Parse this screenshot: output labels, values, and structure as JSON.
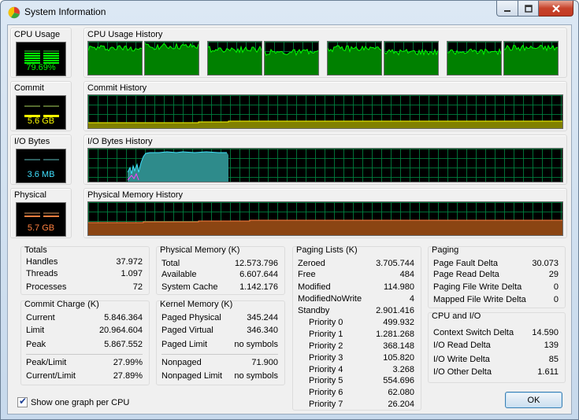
{
  "window": {
    "title": "System Information"
  },
  "meters": {
    "cpu": {
      "label": "CPU Usage",
      "value": "79.69%",
      "color": "#00ff00"
    },
    "commit": {
      "label": "Commit",
      "value": "5.6 GB",
      "color": "#ffff00"
    },
    "io": {
      "label": "I/O Bytes",
      "value": "3.6  MB",
      "color": "#40e0ff"
    },
    "physical": {
      "label": "Physical",
      "value": "5.7 GB",
      "color": "#ff8040"
    }
  },
  "histories": {
    "cpu": "CPU Usage History",
    "commit": "Commit History",
    "io": "I/O Bytes History",
    "physical": "Physical Memory History"
  },
  "cpu_history_graphs": [
    0.82,
    0.86,
    0.78,
    0.69,
    0.8,
    0.7,
    0.72,
    0.82
  ],
  "totals": {
    "title": "Totals",
    "rows": [
      {
        "k": "Handles",
        "v": "37.972"
      },
      {
        "k": "Threads",
        "v": "1.097"
      },
      {
        "k": "Processes",
        "v": "72"
      }
    ]
  },
  "commit_charge": {
    "title": "Commit Charge (K)",
    "rows": [
      {
        "k": "Current",
        "v": "5.846.364"
      },
      {
        "k": "Limit",
        "v": "20.964.604"
      },
      {
        "k": "Peak",
        "v": "5.867.552"
      }
    ],
    "rows2": [
      {
        "k": "Peak/Limit",
        "v": "27.99%"
      },
      {
        "k": "Current/Limit",
        "v": "27.89%"
      }
    ]
  },
  "physical_memory": {
    "title": "Physical Memory (K)",
    "rows": [
      {
        "k": "Total",
        "v": "12.573.796"
      },
      {
        "k": "Available",
        "v": "6.607.644"
      },
      {
        "k": "System Cache",
        "v": "1.142.176"
      }
    ]
  },
  "kernel_memory": {
    "title": "Kernel Memory (K)",
    "rows": [
      {
        "k": "Paged Physical",
        "v": "345.244"
      },
      {
        "k": "Paged Virtual",
        "v": "346.340"
      },
      {
        "k": "Paged Limit",
        "v": "no symbols"
      }
    ],
    "rows2": [
      {
        "k": "Nonpaged",
        "v": "71.900"
      },
      {
        "k": "Nonpaged Limit",
        "v": "no symbols"
      }
    ]
  },
  "paging_lists": {
    "title": "Paging Lists (K)",
    "rows": [
      {
        "k": "Zeroed",
        "v": "3.705.744"
      },
      {
        "k": "Free",
        "v": "484"
      },
      {
        "k": "Modified",
        "v": "114.980"
      },
      {
        "k": "ModifiedNoWrite",
        "v": "4"
      },
      {
        "k": "Standby",
        "v": "2.901.416"
      }
    ],
    "priorities": [
      {
        "k": "Priority 0",
        "v": "499.932"
      },
      {
        "k": "Priority 1",
        "v": "1.281.268"
      },
      {
        "k": "Priority 2",
        "v": "368.148"
      },
      {
        "k": "Priority 3",
        "v": "105.820"
      },
      {
        "k": "Priority 4",
        "v": "3.268"
      },
      {
        "k": "Priority 5",
        "v": "554.696"
      },
      {
        "k": "Priority 6",
        "v": "62.080"
      },
      {
        "k": "Priority 7",
        "v": "26.204"
      }
    ]
  },
  "paging": {
    "title": "Paging",
    "rows": [
      {
        "k": "Page Fault Delta",
        "v": "30.073"
      },
      {
        "k": "Page Read Delta",
        "v": "29"
      },
      {
        "k": "Paging File Write Delta",
        "v": "0"
      },
      {
        "k": "Mapped File Write Delta",
        "v": "0"
      }
    ]
  },
  "cpu_io": {
    "title": "CPU and I/O",
    "rows": [
      {
        "k": "Context Switch Delta",
        "v": "14.590"
      },
      {
        "k": "I/O Read Delta",
        "v": "139"
      },
      {
        "k": "I/O Write Delta",
        "v": "85"
      },
      {
        "k": "I/O Other Delta",
        "v": "1.611"
      }
    ]
  },
  "checkbox": {
    "label": "Show one graph per CPU",
    "checked": true
  },
  "ok_label": "OK"
}
